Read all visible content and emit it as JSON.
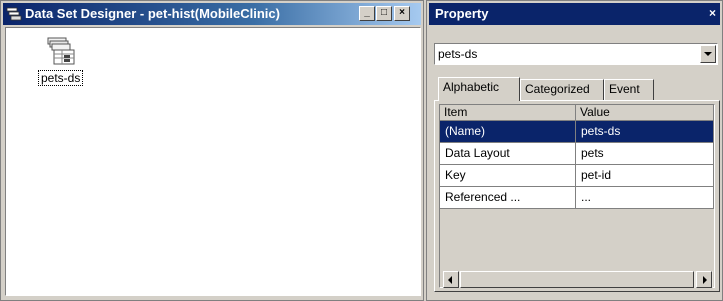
{
  "designer": {
    "title": "Data Set Designer - pet-hist(MobileClinic)",
    "controls": {
      "minimize": "_",
      "maximize": "□",
      "close": "×"
    },
    "item": {
      "label": "pets-ds",
      "icon": "dataset-icon"
    }
  },
  "property": {
    "title": "Property",
    "close": "×",
    "selector": {
      "value": "pets-ds"
    },
    "tabs": [
      "Alphabetic",
      "Categorized",
      "Event"
    ],
    "active_tab": "Alphabetic",
    "columns": [
      "Item",
      "Value"
    ],
    "rows": [
      {
        "item": "(Name)",
        "value": "pets-ds",
        "selected": true
      },
      {
        "item": "Data Layout",
        "value": "pets"
      },
      {
        "item": "Key",
        "value": "pet-id"
      },
      {
        "item": "Referenced ...",
        "value": "..."
      }
    ]
  },
  "colors": {
    "titlebar_active": "#0a246a",
    "selection": "#0a246a",
    "face": "#d4d0c8"
  }
}
